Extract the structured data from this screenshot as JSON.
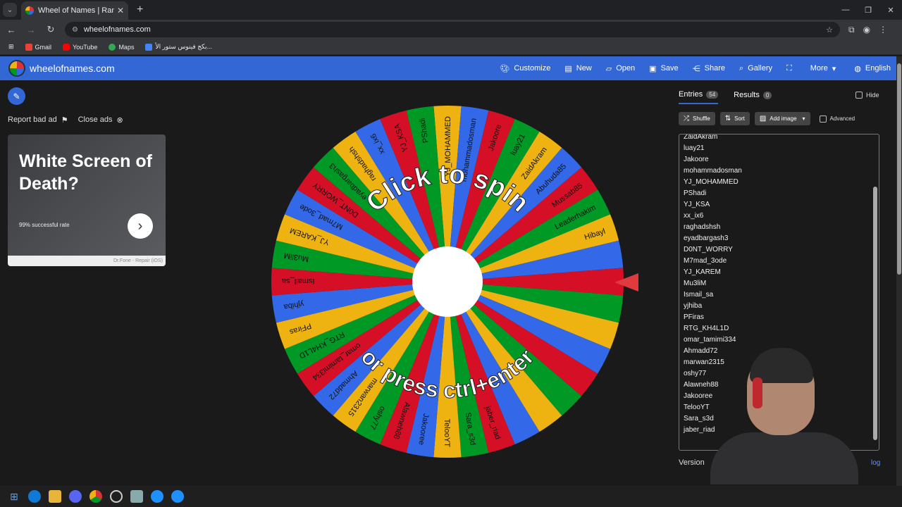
{
  "browser": {
    "tab_title": "Wheel of Names | Random nam",
    "url": "wheelofnames.com",
    "bookmarks": [
      "Gmail",
      "YouTube",
      "Maps",
      "بكج فينوس ستور الأ..."
    ]
  },
  "header": {
    "site_title": "wheelofnames.com",
    "menu": [
      {
        "label": "Customize",
        "icon": "palette-icon"
      },
      {
        "label": "New",
        "icon": "file-icon"
      },
      {
        "label": "Open",
        "icon": "folder-icon"
      },
      {
        "label": "Save",
        "icon": "save-icon"
      },
      {
        "label": "Share",
        "icon": "share-icon"
      },
      {
        "label": "Gallery",
        "icon": "search-icon"
      },
      {
        "label": "",
        "icon": "fullscreen-icon"
      },
      {
        "label": "More",
        "icon": "chevron-down-icon"
      },
      {
        "label": "English",
        "icon": "globe-icon"
      }
    ]
  },
  "ad": {
    "report_label": "Report bad ad",
    "close_label": "Close ads",
    "headline": "White Screen of Death?",
    "subline": "99% successful rate",
    "footer": "Dr.Fone - Repair (iOS)"
  },
  "wheel": {
    "top_text": "Click to spin",
    "bottom_text": "or press ctrl+enter",
    "colors": [
      "#eeb211",
      "#3369e8",
      "#d50f25",
      "#009925"
    ],
    "slices": [
      "YJ_MOHAMMED",
      "mohammadosman",
      "Jakoore",
      "luay21",
      "ZaidAkram",
      "Abuhuda85",
      "Mussab85",
      "Leaderhakim",
      "Hibayl",
      "",
      "",
      "",
      "",
      "",
      "",
      "",
      "",
      "",
      "jaber_riad",
      "Sara_s3d",
      "TelooYT",
      "Jakooree",
      "Alawneh88",
      "oshy77",
      "marwan2315",
      "Ahmadd72",
      "omar_tamimi334",
      "RTG_KH4L1D",
      "PFiras",
      "yjhiba",
      "Ismail_sa",
      "Mu3liM",
      "YJ_KAREM",
      "M7mad_3ode",
      "D0NT_WORRY",
      "eyadbargash3",
      "raghadshsh",
      "xx_ix6",
      "YJ_KSA",
      "PShadi"
    ]
  },
  "panel": {
    "tabs": [
      {
        "label": "Entries",
        "count": "54"
      },
      {
        "label": "Results",
        "count": "0"
      }
    ],
    "hide_label": "Hide",
    "toolbar": {
      "shuffle": "Shuffle",
      "sort": "Sort",
      "add_image": "Add image",
      "advanced": "Advanced"
    },
    "entries": [
      "ZaidAkram",
      "luay21",
      "Jakoore",
      "mohammadosman",
      "YJ_MOHAMMED",
      "PShadi",
      "YJ_KSA",
      "xx_ix6",
      "raghadshsh",
      "eyadbargash3",
      "D0NT_WORRY",
      "M7mad_3ode",
      "YJ_KAREM",
      "Mu3liM",
      "Ismail_sa",
      "yjhiba",
      "PFiras",
      "RTG_KH4L1D",
      "omar_tamimi334",
      "Ahmadd72",
      "marwan2315",
      "oshy77",
      "Alawneh88",
      "Jakooree",
      "TelooYT",
      "Sara_s3d",
      "jaber_riad"
    ],
    "version_label": "Version",
    "changelog_label": "log"
  }
}
